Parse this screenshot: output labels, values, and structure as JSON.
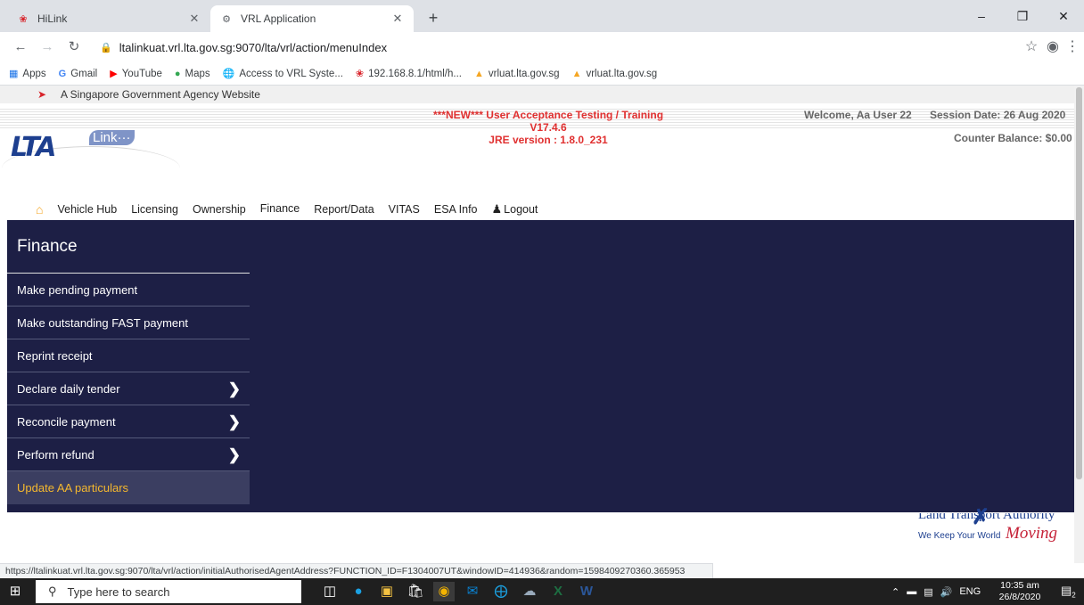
{
  "browser": {
    "tabs": [
      {
        "title": "HiLink",
        "active": false
      },
      {
        "title": "VRL Application",
        "active": true
      }
    ],
    "url": "ltalinkuat.vrl.lta.gov.sg:9070/lta/vrl/action/menuIndex",
    "bookmarks": [
      {
        "label": "Apps",
        "icon": "apps-grid-icon"
      },
      {
        "label": "Gmail",
        "icon": "google-icon"
      },
      {
        "label": "YouTube",
        "icon": "youtube-icon"
      },
      {
        "label": "Maps",
        "icon": "maps-icon"
      },
      {
        "label": "Access to VRL Syste...",
        "icon": "globe-icon"
      },
      {
        "label": "192.168.8.1/html/h...",
        "icon": "huawei-icon"
      },
      {
        "label": "vrluat.lta.gov.sg",
        "icon": "lta-icon"
      },
      {
        "label": "vrluat.lta.gov.sg",
        "icon": "lta-icon"
      }
    ],
    "status_url": "https://ltalinkuat.vrl.lta.gov.sg:9070/lta/vrl/action/initialAuthorisedAgentAddress?FUNCTION_ID=F1304007UT&windowID=414936&random=1598409270360.365953"
  },
  "page": {
    "gov_banner": "A Singapore Government Agency Website",
    "logo_text": "Link···",
    "uat_notice": {
      "line1": "***NEW*** User Acceptance Testing / Training",
      "line2": "V17.4.6",
      "line3": "JRE version : 1.8.0_231"
    },
    "welcome": "Welcome, Aa User 22",
    "session_date": "Session Date: 26 Aug 2020",
    "counter_balance": "Counter Balance: $0.00",
    "menu": [
      "Vehicle Hub",
      "Licensing",
      "Ownership",
      "Finance",
      "Report/Data",
      "VITAS",
      "ESA Info",
      "Logout"
    ],
    "active_menu": "Finance",
    "sidebar": {
      "title": "Finance",
      "items": [
        {
          "label": "Make pending payment",
          "submenu": false
        },
        {
          "label": "Make outstanding FAST payment",
          "submenu": false
        },
        {
          "label": "Reprint receipt",
          "submenu": false
        },
        {
          "label": "Declare daily tender",
          "submenu": true
        },
        {
          "label": "Reconcile payment",
          "submenu": true
        },
        {
          "label": "Perform refund",
          "submenu": true
        },
        {
          "label": "Update AA particulars",
          "submenu": false,
          "highlighted": true
        }
      ]
    },
    "footer": {
      "agency": "Land Transport Authority",
      "tagline": "We Keep Your World",
      "moving": "Moving"
    }
  },
  "taskbar": {
    "search_placeholder": "Type here to search",
    "language": "ENG",
    "time": "10:35 am",
    "date": "26/8/2020",
    "notifications": "2"
  },
  "colors": {
    "nav_bg": "#1d1f45",
    "highlight_text": "#f5b82e",
    "uat_red": "#e03030",
    "lta_blue": "#1d3f8f"
  }
}
